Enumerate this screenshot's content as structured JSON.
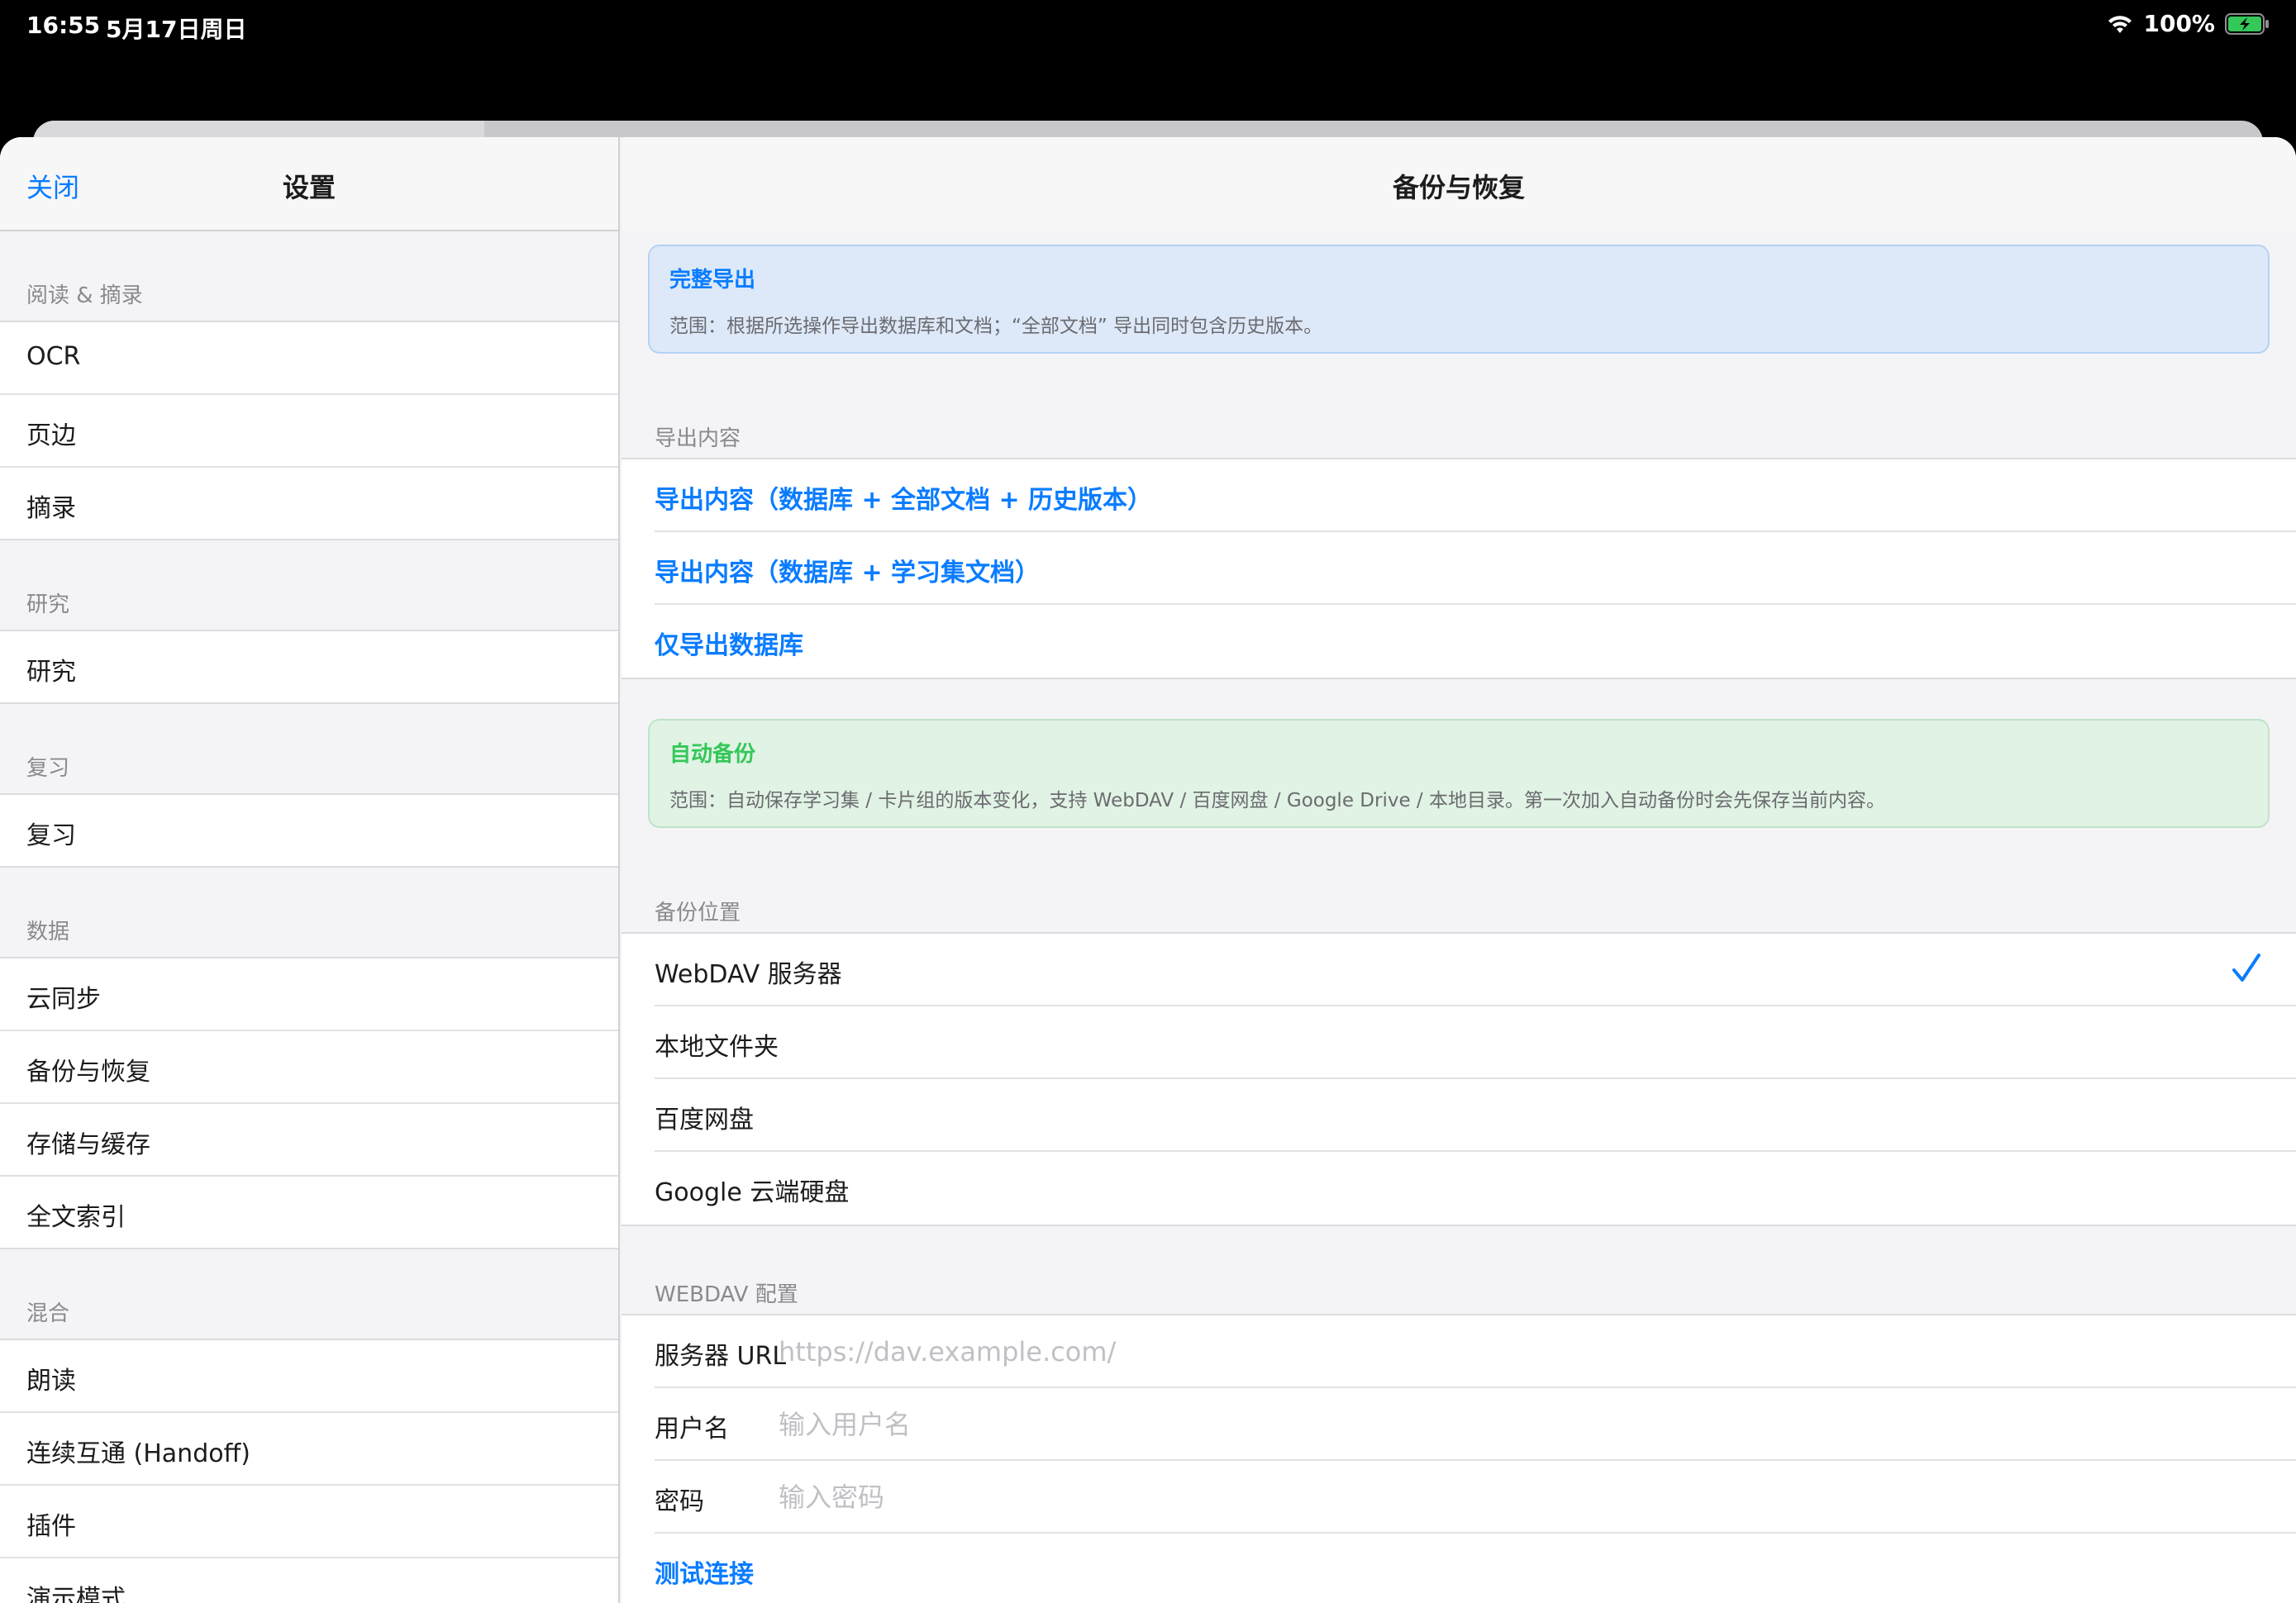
{
  "status_bar": {
    "time": "16:55",
    "date": "5月17日周日",
    "battery": "100%"
  },
  "sidebar": {
    "close_label": "关闭",
    "title": "设置",
    "sections": [
      {
        "header": "阅读 & 摘录",
        "items": [
          "OCR",
          "页边",
          "摘录"
        ]
      },
      {
        "header": "研究",
        "items": [
          "研究"
        ]
      },
      {
        "header": "复习",
        "items": [
          "复习"
        ]
      },
      {
        "header": "数据",
        "items": [
          "云同步",
          "备份与恢复",
          "存储与缓存",
          "全文索引"
        ]
      },
      {
        "header": "混合",
        "items": [
          "朗读",
          "连续互通 (Handoff)",
          "插件",
          "演示模式"
        ]
      }
    ]
  },
  "detail": {
    "title": "备份与恢复",
    "full_export": {
      "title": "完整导出",
      "text": "范围：根据所选操作导出数据库和文档；“全部文档” 导出同时包含历史版本。"
    },
    "export_section": {
      "header": "导出内容",
      "items": [
        "导出内容（数据库 + 全部文档 + 历史版本）",
        "导出内容（数据库 + 学习集文档）",
        "仅导出数据库"
      ]
    },
    "auto_backup": {
      "title": "自动备份",
      "text": "范围：自动保存学习集 / 卡片组的版本变化，支持 WebDAV / 百度网盘 / Google Drive / 本地目录。第一次加入自动备份时会先保存当前内容。"
    },
    "location_section": {
      "header": "备份位置",
      "items": [
        "WebDAV 服务器",
        "本地文件夹",
        "百度网盘",
        "Google 云端硬盘"
      ],
      "selected": "WebDAV 服务器"
    },
    "webdav_section": {
      "header": "WEBDAV 配置",
      "fields": [
        {
          "label": "服务器 URL",
          "value": "",
          "placeholder": "https://dav.example.com/"
        },
        {
          "label": "用户名",
          "value": "",
          "placeholder": "输入用户名"
        },
        {
          "label": "密码",
          "value": "",
          "placeholder": "输入密码"
        }
      ],
      "test_label": "测试连接"
    }
  },
  "colors": {
    "accent": "#0a7cff",
    "success": "#34c759",
    "info_blue_bg": "#dde9f8",
    "info_green_bg": "#e0f3e4"
  }
}
